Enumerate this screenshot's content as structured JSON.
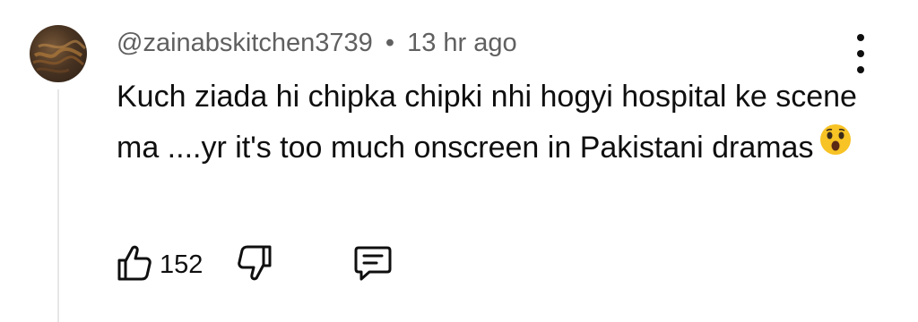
{
  "comment": {
    "author": "@zainabskitchen3739",
    "separator": "•",
    "time": "13 hr ago",
    "text": "Kuch ziada hi chipka chipki nhi hogyi hospital ke scene ma ....yr it's too much onscreen in Pakistani dramas",
    "emoji_icon": "astonished-face-icon",
    "likes": "152"
  },
  "icons": {
    "avatar": "avatar",
    "menu": "more-vert-icon",
    "like": "thumbs-up-icon",
    "dislike": "thumbs-down-icon",
    "reply": "reply-comment-icon"
  },
  "colors": {
    "meta_text": "#606060",
    "body_text": "#0f0f0f",
    "thread_line": "#e6e6e6",
    "emoji_yellow": "#f7c325"
  }
}
